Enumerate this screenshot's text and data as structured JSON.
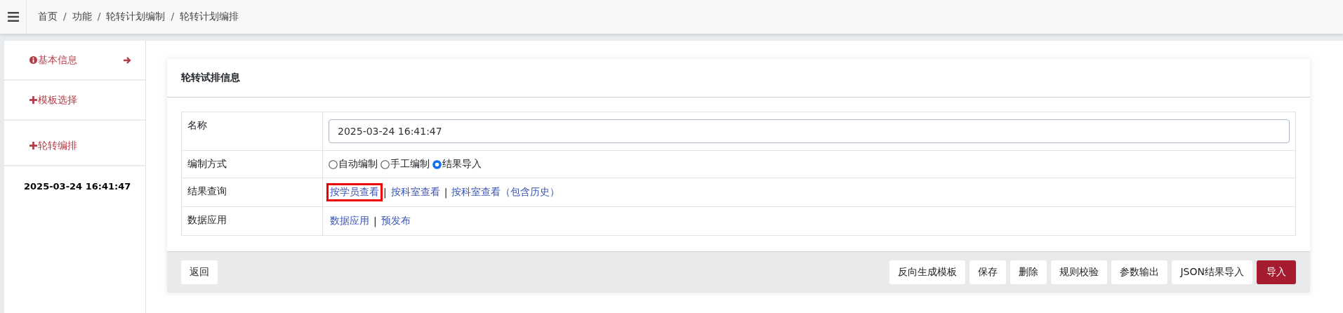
{
  "breadcrumb": [
    "首页",
    "功能",
    "轮转计划编制",
    "轮转计划编排"
  ],
  "breadcrumb_separator": "/",
  "link_separator": "|",
  "sidebar": {
    "items": [
      {
        "kind": "info",
        "label": "基本信息",
        "selected": true
      },
      {
        "kind": "plus",
        "label": "模板选择",
        "selected": false
      },
      {
        "kind": "plus",
        "label": "轮转编排",
        "selected": false
      },
      {
        "kind": "date",
        "label": "2025-03-24 16:41:47",
        "selected": false
      }
    ]
  },
  "card": {
    "title": "轮转试排信息",
    "rows": [
      {
        "kind": "input",
        "label": "名称",
        "value": "2025-03-24 16:41:47"
      },
      {
        "kind": "radios",
        "label": "编制方式",
        "options": [
          {
            "label": "自动编制",
            "selected": false
          },
          {
            "label": "手工编制",
            "selected": false
          },
          {
            "label": "结果导入",
            "selected": true
          }
        ]
      },
      {
        "kind": "links",
        "label": "结果查询",
        "links": [
          {
            "label": "按学员查看",
            "highlighted": true
          },
          {
            "label": "按科室查看",
            "highlighted": false
          },
          {
            "label": "按科室查看（包含历史）",
            "highlighted": false
          }
        ]
      },
      {
        "kind": "links",
        "label": "数据应用",
        "links": [
          {
            "label": "数据应用",
            "highlighted": false
          },
          {
            "label": "预发布",
            "highlighted": false
          }
        ]
      }
    ],
    "back_button": "返回",
    "buttons": [
      {
        "label": "反向生成模板",
        "primary": false
      },
      {
        "label": "保存",
        "primary": false
      },
      {
        "label": "删除",
        "primary": false
      },
      {
        "label": "规则校验",
        "primary": false
      },
      {
        "label": "参数输出",
        "primary": false
      },
      {
        "label": "JSON结果导入",
        "primary": false
      },
      {
        "label": "导入",
        "primary": true
      }
    ]
  }
}
